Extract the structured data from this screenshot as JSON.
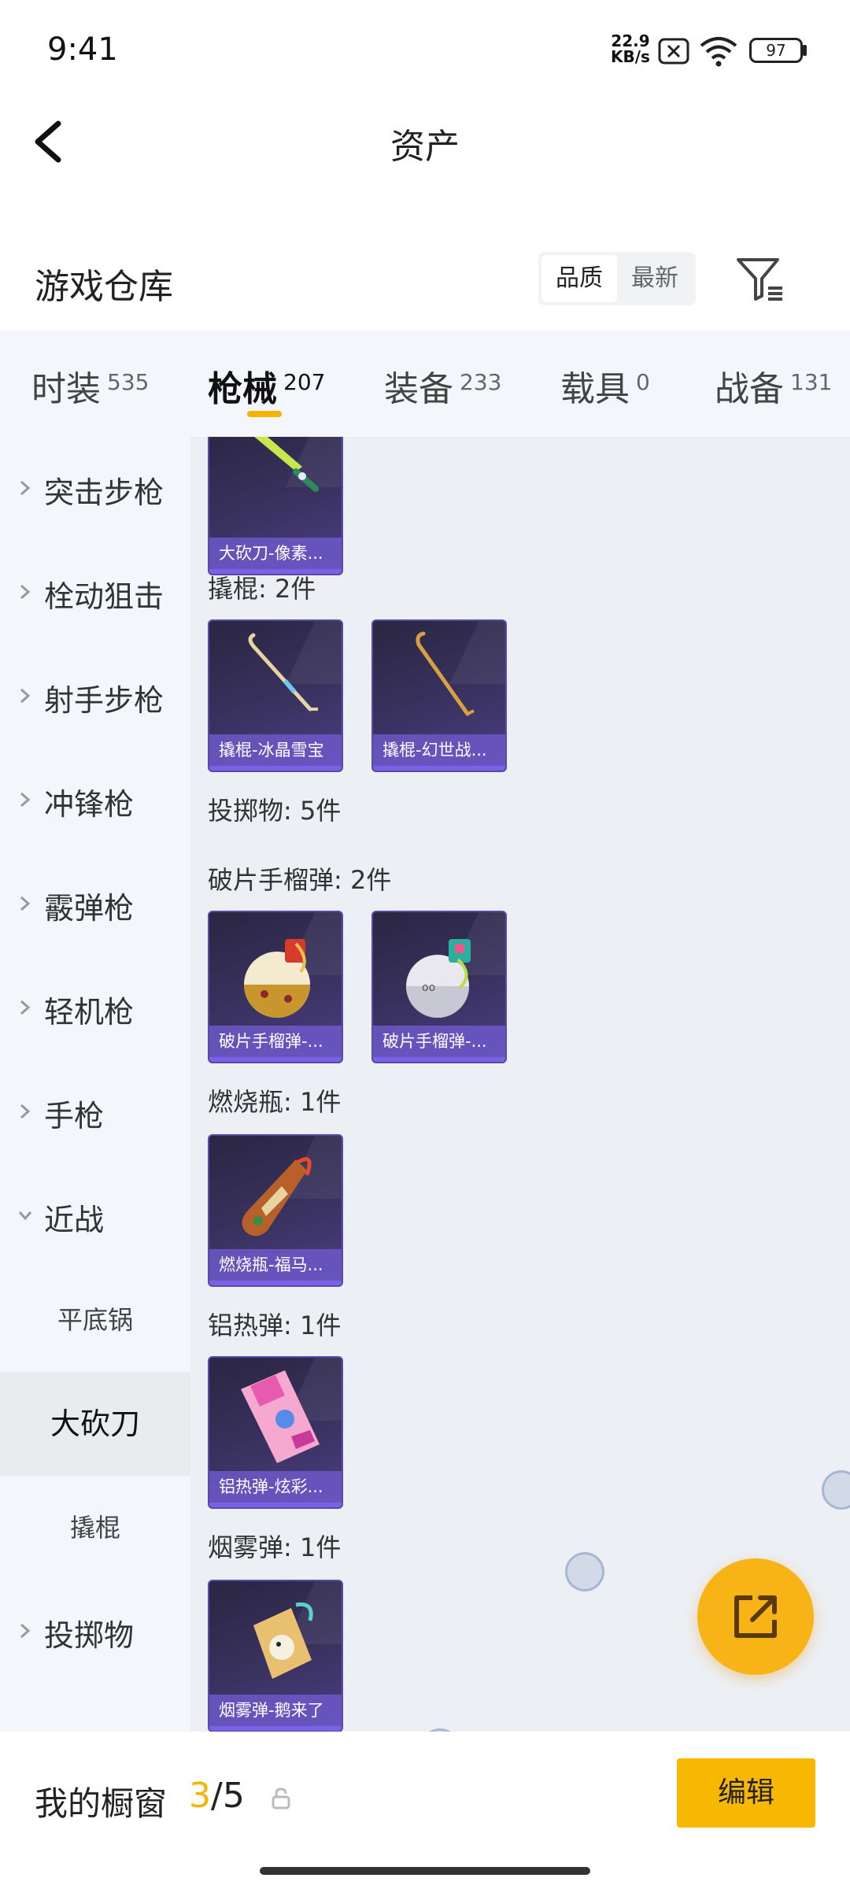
{
  "status": {
    "time": "9:41",
    "net_speed_value": "22.9",
    "net_speed_unit": "KB/s",
    "battery": "97"
  },
  "header": {
    "title": "资产"
  },
  "section": {
    "title": "游戏仓库",
    "sort_quality": "品质",
    "sort_newest": "最新"
  },
  "tabs": [
    {
      "label": "时装",
      "count": "535"
    },
    {
      "label": "枪械",
      "count": "207"
    },
    {
      "label": "装备",
      "count": "233"
    },
    {
      "label": "载具",
      "count": "0"
    },
    {
      "label": "战备",
      "count": "131"
    }
  ],
  "sidebar": {
    "items": [
      "突击步枪",
      "栓动狙击",
      "射手步枪",
      "冲锋枪",
      "霰弹枪",
      "轻机枪",
      "手枪",
      "近战"
    ],
    "sub_items": [
      "平底锅",
      "大砍刀",
      "撬棍"
    ],
    "after": "投掷物"
  },
  "content": {
    "groups": [
      {
        "label": "撬棍: 2件"
      },
      {
        "label": "投掷物: 5件"
      },
      {
        "label": "破片手榴弹: 2件"
      },
      {
        "label": "燃烧瓶: 1件"
      },
      {
        "label": "铝热弹: 1件"
      },
      {
        "label": "烟雾弹: 1件"
      }
    ],
    "cards": [
      "大砍刀-像素...",
      "撬棍-冰晶雪宝",
      "撬棍-幻世战...",
      "破片手榴弹-...",
      "破片手榴弹-...",
      "燃烧瓶-福马...",
      "铝热弹-炫彩...",
      "烟雾弹-鹅来了"
    ]
  },
  "bottom": {
    "label": "我的橱窗",
    "current": "3",
    "total": "/5",
    "edit": "编辑"
  }
}
